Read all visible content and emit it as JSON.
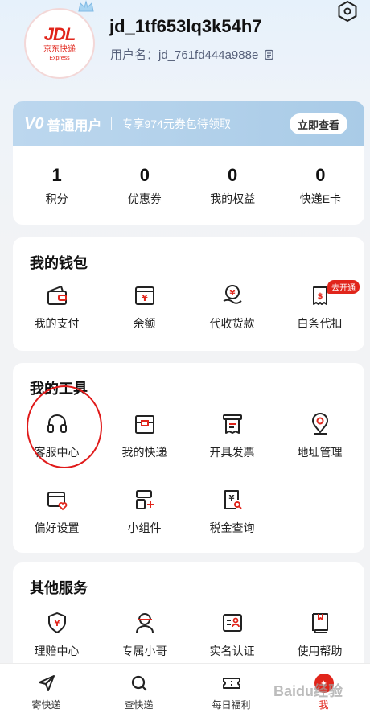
{
  "profile": {
    "logo_main": "JDL",
    "logo_sub": "京东快递",
    "logo_en": "Express",
    "user_id": "jd_1tf653lq3k54h7",
    "username_line": "用户名：jd_761fd444a988e",
    "icons": {
      "settings": "settings-hexagon-icon",
      "copy": "copy-icon"
    }
  },
  "membership": {
    "level": "V0",
    "level_name": "普通用户",
    "promo": "专享974元券包待领取",
    "button": "立即查看",
    "stats": [
      {
        "value": "1",
        "label": "积分"
      },
      {
        "value": "0",
        "label": "优惠券"
      },
      {
        "value": "0",
        "label": "我的权益"
      },
      {
        "value": "0",
        "label": "快递E卡"
      }
    ]
  },
  "wallet": {
    "title": "我的钱包",
    "items": [
      {
        "label": "我的支付",
        "icon": "wallet-icon"
      },
      {
        "label": "余额",
        "icon": "balance-icon"
      },
      {
        "label": "代收货款",
        "icon": "cod-payment-icon"
      },
      {
        "label": "白条代扣",
        "icon": "receipt-icon",
        "badge": "去开通"
      }
    ]
  },
  "tools": {
    "title": "我的工具",
    "row1": [
      {
        "label": "客服中心",
        "icon": "headset-icon"
      },
      {
        "label": "我的快递",
        "icon": "package-icon"
      },
      {
        "label": "开具发票",
        "icon": "invoice-icon"
      },
      {
        "label": "地址管理",
        "icon": "location-pin-icon"
      }
    ],
    "row2": [
      {
        "label": "偏好设置",
        "icon": "preference-card-icon"
      },
      {
        "label": "小组件",
        "icon": "widget-icon"
      },
      {
        "label": "税金查询",
        "icon": "tax-search-icon"
      }
    ]
  },
  "others": {
    "title": "其他服务",
    "items": [
      {
        "label": "理赔中心",
        "icon": "claim-shield-icon"
      },
      {
        "label": "专属小哥",
        "icon": "courier-icon"
      },
      {
        "label": "实名认证",
        "icon": "id-card-icon"
      },
      {
        "label": "使用帮助",
        "icon": "help-book-icon"
      }
    ]
  },
  "tabbar": {
    "tabs": [
      {
        "label": "寄快递",
        "icon": "send-paper-plane-icon"
      },
      {
        "label": "查快递",
        "icon": "search-icon"
      },
      {
        "label": "每日福利",
        "icon": "ticket-icon"
      },
      {
        "label": "我",
        "icon": "me-avatar-icon"
      }
    ],
    "active_color": "#e1251b"
  },
  "watermark": "Baidu经验",
  "colors": {
    "accent": "#e1251b",
    "member_bar": "#a9cbe7"
  }
}
